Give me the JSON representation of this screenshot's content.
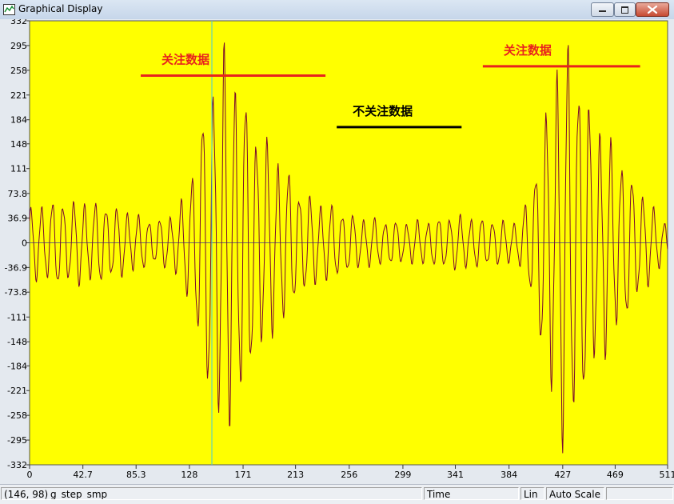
{
  "window": {
    "title": "Graphical Display",
    "icon": "graph-icon",
    "controls": {
      "minimize": "minimize-icon",
      "maximize": "maximize-icon",
      "close": "close-icon"
    }
  },
  "status_bar": {
    "coordinates": "(146, 98)",
    "signal_name": "g_step_smp",
    "x_axis_mode": "Time",
    "y_scale_mode": "Lin",
    "scaling": "Auto Scale"
  },
  "colors": {
    "plot_background": "#ffff00",
    "trace": "#7a0a2e",
    "cursor": "#44ccdd",
    "annotation_focus": "#e8231d",
    "annotation_ignore": "#000000"
  },
  "chart_data": {
    "type": "line",
    "x_ticks": [
      "0",
      "42.7",
      "85.3",
      "128",
      "171",
      "213",
      "256",
      "299",
      "341",
      "384",
      "427",
      "469",
      "511"
    ],
    "y_ticks": [
      "332",
      "295",
      "258",
      "221",
      "184",
      "148",
      "111",
      "73.8",
      "36.9",
      "0",
      "-36.9",
      "-73.8",
      "-111",
      "-148",
      "-184",
      "-221",
      "-258",
      "-295",
      "-332"
    ],
    "xlim": [
      0,
      511
    ],
    "ylim": [
      -332,
      332
    ],
    "grid": false,
    "zero_line": true,
    "cursor_x": 146,
    "series": [
      {
        "amplitude_profile": [
          [
            0,
            50
          ],
          [
            20,
            62
          ],
          [
            40,
            60
          ],
          [
            60,
            58
          ],
          [
            80,
            45
          ],
          [
            100,
            32
          ],
          [
            115,
            42
          ],
          [
            125,
            70
          ],
          [
            133,
            130
          ],
          [
            140,
            200
          ],
          [
            148,
            250
          ],
          [
            155,
            275
          ],
          [
            162,
            262
          ],
          [
            172,
            220
          ],
          [
            180,
            175
          ],
          [
            190,
            145
          ],
          [
            205,
            112
          ],
          [
            215,
            80
          ],
          [
            228,
            62
          ],
          [
            245,
            52
          ],
          [
            262,
            38
          ],
          [
            280,
            34
          ],
          [
            300,
            30
          ],
          [
            320,
            33
          ],
          [
            340,
            40
          ],
          [
            360,
            36
          ],
          [
            378,
            32
          ],
          [
            392,
            30
          ],
          [
            402,
            85
          ],
          [
            412,
            175
          ],
          [
            420,
            250
          ],
          [
            428,
            295
          ],
          [
            436,
            280
          ],
          [
            445,
            225
          ],
          [
            455,
            175
          ],
          [
            465,
            150
          ],
          [
            475,
            120
          ],
          [
            485,
            90
          ],
          [
            495,
            62
          ],
          [
            505,
            40
          ],
          [
            511,
            25
          ]
        ],
        "period": 8.6
      }
    ],
    "annotations": [
      {
        "text": "关注数据",
        "x_range": [
          89,
          237
        ],
        "y": 250,
        "color": "focus"
      },
      {
        "text": "不关注数据",
        "x_range": [
          246,
          346
        ],
        "y": 173,
        "color": "ignore"
      },
      {
        "text": "关注数据",
        "x_range": [
          363,
          489
        ],
        "y": 264,
        "color": "focus"
      }
    ]
  }
}
